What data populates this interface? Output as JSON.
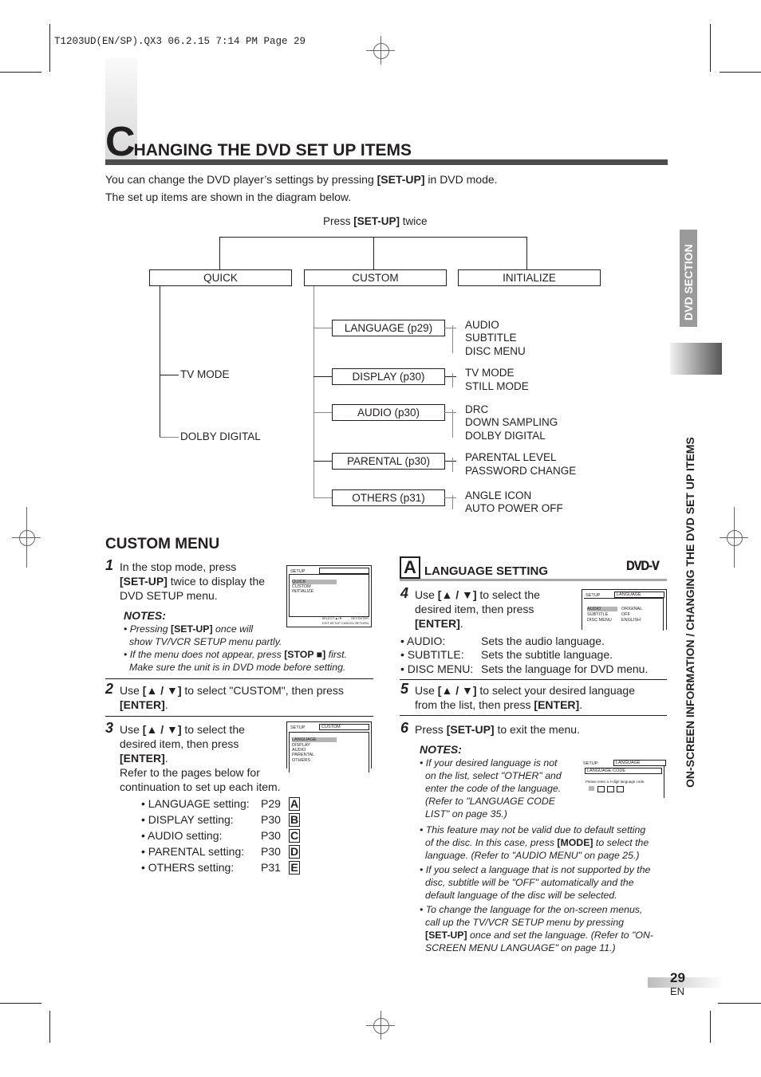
{
  "print_header": "T1203UD(EN/SP).QX3   06.2.15   7:14 PM   Page 29",
  "title": {
    "initial": "C",
    "rest": "HANGING THE DVD SET UP ITEMS"
  },
  "intro": {
    "line1_pre": "You can change the DVD player’s settings by pressing ",
    "line1_key": "[SET-UP]",
    "line1_post": " in DVD mode.",
    "line2": "The set up items are shown in the diagram below."
  },
  "diagram": {
    "root_pre": "Press ",
    "root_key": "[SET-UP]",
    "root_post": " twice",
    "top_items": [
      "QUICK",
      "CUSTOM",
      "INITIALIZE"
    ],
    "quick_children": [
      "TV MODE",
      "DOLBY DIGITAL"
    ],
    "custom_children": [
      {
        "label": "LANGUAGE (p29)",
        "subs": [
          "AUDIO",
          "SUBTITLE",
          "DISC MENU"
        ]
      },
      {
        "label": "DISPLAY (p30)",
        "subs": [
          "TV MODE",
          "STILL MODE"
        ]
      },
      {
        "label": "AUDIO (p30)",
        "subs": [
          "DRC",
          "DOWN SAMPLING",
          "DOLBY DIGITAL"
        ]
      },
      {
        "label": "PARENTAL (p30)",
        "subs": [
          "PARENTAL LEVEL",
          "PASSWORD CHANGE"
        ]
      },
      {
        "label": "OTHERS (p31)",
        "subs": [
          "ANGLE ICON",
          "AUTO POWER OFF"
        ]
      }
    ]
  },
  "custom_menu": {
    "heading": "CUSTOM MENU",
    "step1": {
      "num": "1",
      "t1": "In the stop mode, press",
      "key": "[SET-UP]",
      "t2": " twice to display the",
      "t3": "DVD SETUP menu."
    },
    "notes_heading": "NOTES:",
    "note1_pre": "• Pressing ",
    "note1_key": "[SET-UP]",
    "note1_post": " once will",
    "note1_l2": "show TV/VCR SETUP menu partly.",
    "note2_pre": "• If the menu does not appear, press ",
    "note2_key": "[STOP ■]",
    "note2_post": " first.",
    "note2_l2": "Make sure the unit is in DVD mode before setting.",
    "screen1": {
      "header": "SETUP",
      "items": [
        "QUICK",
        "CUSTOM",
        "INITIALIZE"
      ],
      "footer1": "SELECT:▲/▼          SET:ENTER",
      "footer2": "EXIT:SETUP  CANCEL:RETURN"
    },
    "step2": {
      "num": "2",
      "t1": "Use ",
      "key": "[▲ / ▼]",
      "t2": " to select \"CUSTOM\", then press",
      "key2": "[ENTER]",
      "t3": "."
    },
    "step3": {
      "num": "3",
      "t1": "Use ",
      "key": "[▲ / ▼]",
      "t2": " to select the",
      "l2": "desired item, then press",
      "key2": "[ENTER]",
      "l4": "Refer to the pages below for",
      "l5": "continuation to set up each item."
    },
    "screen2": {
      "header": "SETUP",
      "title": "CUSTOM",
      "items": [
        "LANGUAGE",
        "DISPLAY",
        "AUDIO",
        "PARENTAL",
        "OTHERS"
      ]
    },
    "refs": [
      {
        "label": "• LANGUAGE setting:",
        "page": "P29",
        "letter": "A"
      },
      {
        "label": "• DISPLAY setting:",
        "page": "P30",
        "letter": "B"
      },
      {
        "label": "• AUDIO setting:",
        "page": "P30",
        "letter": "C"
      },
      {
        "label": "• PARENTAL setting:",
        "page": "P30",
        "letter": "D"
      },
      {
        "label": "• OTHERS setting:",
        "page": "P31",
        "letter": "E"
      }
    ]
  },
  "language_setting": {
    "letter": "A",
    "heading": "LANGUAGE SETTING",
    "badge": "DVD-V",
    "step4": {
      "num": "4",
      "t1": "Use ",
      "key": "[▲ / ▼]",
      "t2": " to select the",
      "l2": "desired item, then press",
      "key2": "[ENTER]"
    },
    "screen3": {
      "header": "SETUP",
      "title": "LANGUAGE",
      "rows": [
        [
          "AUDIO",
          "ORIGINAL"
        ],
        [
          "SUBTITLE",
          "OFF"
        ],
        [
          "DISC MENU",
          "ENGLISH"
        ]
      ]
    },
    "defs": [
      {
        "term": "• AUDIO:",
        "desc": "Sets the audio language."
      },
      {
        "term": "• SUBTITLE:",
        "desc": "Sets the subtitle language."
      },
      {
        "term": "• DISC MENU:",
        "desc": "Sets the language for DVD menu."
      }
    ],
    "step5": {
      "num": "5",
      "t1": "Use ",
      "key": "[▲ / ▼]",
      "t2": " to select your desired language",
      "l2": "from the list, then press ",
      "key2": "[ENTER]"
    },
    "step6": {
      "num": "6",
      "t1": "Press ",
      "key": "[SET-UP]",
      "t2": " to exit the menu."
    },
    "notes_heading": "NOTES:",
    "screen4": {
      "header": "SETUP",
      "title": "LANGUAGE",
      "sub": "LANGUAGE CODE",
      "prompt": "Please enter a 4-digit language code."
    },
    "notes": [
      [
        "• If your desired language is not",
        "on the list, select \"OTHER\" and",
        "enter the code of the language.",
        "(Refer to \"LANGUAGE CODE",
        "LIST\" on page 35.)"
      ],
      [
        "• This feature may not be valid due to default setting",
        "of the disc. In this case, press |[MODE]| to select the",
        "language. (Refer to \"AUDIO MENU\" on page 25.)"
      ],
      [
        "• If you select a language that is not supported by the",
        "disc, subtitle will be \"OFF\" automatically and the",
        "default language of the disc will be selected."
      ],
      [
        "• To change the language for the on-screen menus,",
        "call up the TV/VCR SETUP menu by pressing",
        "|[SET-UP]| once and set the language. (Refer to \"ON-",
        "SCREEN MENU LANGUAGE\" on page 11.)"
      ]
    ]
  },
  "side_tabs": {
    "section": "DVD SECTION",
    "chapter": "ON-SCREEN INFORMATION / CHANGING THE DVD SET UP ITEMS"
  },
  "footer": {
    "page": "29",
    "lang": "EN"
  }
}
